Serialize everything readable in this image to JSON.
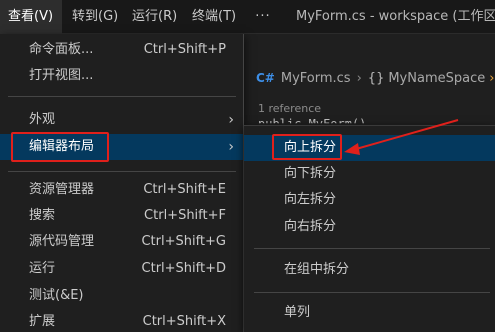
{
  "menubar": {
    "items": [
      {
        "label": "查看(V)"
      },
      {
        "label": "转到(G)"
      },
      {
        "label": "运行(R)"
      },
      {
        "label": "终端(T)"
      },
      {
        "label": "···"
      }
    ],
    "window_title": "MyForm.cs - workspace (工作区) - Vi"
  },
  "editor": {
    "breadcrumb": {
      "file_icon": "C#",
      "file": "MyForm.cs",
      "separator": "›",
      "namespace_icon": "{}",
      "namespace": "MyNameSpace",
      "tail": "›"
    },
    "codelens": "1 reference",
    "code_line": "public MyForm()"
  },
  "view_menu": {
    "items": [
      {
        "label": "命令面板...",
        "shortcut": "Ctrl+Shift+P"
      },
      {
        "label": "打开视图...",
        "shortcut": ""
      },
      {
        "label": "外观",
        "chevron": "›"
      },
      {
        "label": "编辑器布局",
        "chevron": "›"
      },
      {
        "label": "资源管理器",
        "shortcut": "Ctrl+Shift+E"
      },
      {
        "label": "搜索",
        "shortcut": "Ctrl+Shift+F"
      },
      {
        "label": "源代码管理",
        "shortcut": "Ctrl+Shift+G"
      },
      {
        "label": "运行",
        "shortcut": "Ctrl+Shift+D"
      },
      {
        "label": "测试(&E)",
        "shortcut": ""
      },
      {
        "label": "扩展",
        "shortcut": "Ctrl+Shift+X"
      }
    ]
  },
  "layout_submenu": {
    "items": [
      {
        "label": "向上拆分"
      },
      {
        "label": "向下拆分"
      },
      {
        "label": "向左拆分"
      },
      {
        "label": "向右拆分"
      },
      {
        "label": "在组中拆分"
      },
      {
        "label": "单列"
      }
    ]
  },
  "colors": {
    "annotation": "#e0201b",
    "selection": "#04395e",
    "menu_background": "#1f1f1f"
  }
}
